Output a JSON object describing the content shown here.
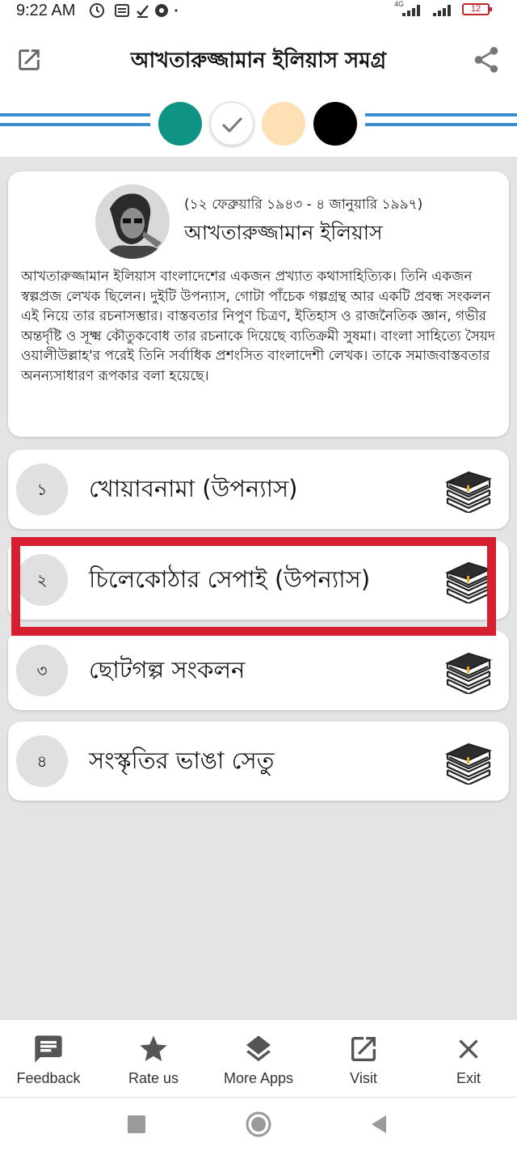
{
  "status": {
    "time": "9:22 AM",
    "network": "4G",
    "battery": "12"
  },
  "app": {
    "title": "আখতারুজ্জামান ইলিয়াস সমগ্র"
  },
  "theme": {
    "colors": [
      "#0f9385",
      "#ffffff",
      "#fde0b3",
      "#000000"
    ],
    "selected_index": 1,
    "stripe_color": "#3a8fd0"
  },
  "author": {
    "dates": "(১২ ফেব্রুয়ারি ১৯৪৩ - ৪ জানুয়ারি ১৯৯৭)",
    "name": "আখতারুজ্জামান ইলিয়াস",
    "description": "আখতারুজ্জামান ইলিয়াস বাংলাদেশের একজন প্রখ্যাত কথাসাহিত্যিক। তিনি একজন স্বল্পপ্রজ লেখক ছিলেন। দুইটি উপন্যাস, গোটা পাঁচেক গল্পগ্রন্থ আর একটি প্রবন্ধ সংকলন এই নিয়ে তার রচনাসম্ভার। বাস্তবতার নিপুণ চিত্রণ, ইতিহাস ও রাজনৈতিক জ্ঞান, গভীর অন্তর্দৃষ্টি ও সূক্ষ্ম কৌতুকবোধ তার রচনাকে দিয়েছে ব্যতিক্রমী সুষমা। বাংলা সাহিত্যে সৈয়দ ওয়ালীউল্লাহ'র পরেই তিনি সর্বাধিক প্রশংসিত বাংলাদেশী লেখক। তাকে সমাজবাস্তবতার অনন্যসাধারণ রূপকার বলা হয়েছে।"
  },
  "books": [
    {
      "num": "১",
      "title": "খোয়াবনামা (উপন্যাস)"
    },
    {
      "num": "২",
      "title": "চিলেকোঠার সেপাই (উপন্যাস)"
    },
    {
      "num": "৩",
      "title": "ছোটগল্প সংকলন"
    },
    {
      "num": "৪",
      "title": "সংস্কৃতির ভাঙা সেতু"
    }
  ],
  "nav": {
    "feedback": "Feedback",
    "rate": "Rate us",
    "more_apps": "More Apps",
    "visit": "Visit",
    "exit": "Exit"
  },
  "highlight_color": "#d61f30"
}
